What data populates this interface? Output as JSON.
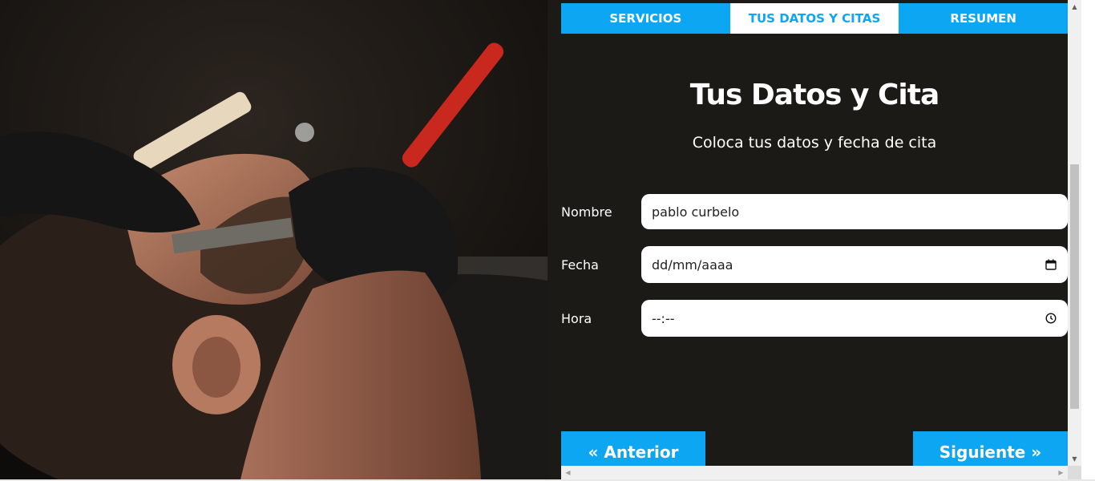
{
  "tabs": [
    {
      "label": "Servicios",
      "active": false
    },
    {
      "label": "Tus Datos y Citas",
      "active": true
    },
    {
      "label": "Resumen",
      "active": false
    }
  ],
  "section": {
    "title": "Tus Datos y Cita",
    "subtitle": "Coloca tus datos y fecha de cita"
  },
  "form": {
    "nombre": {
      "label": "Nombre",
      "value": "pablo curbelo"
    },
    "fecha": {
      "label": "Fecha",
      "placeholder": "dd/mm/aaaa",
      "icon": "calendar-icon"
    },
    "hora": {
      "label": "Hora",
      "placeholder": "--:--",
      "icon": "clock-icon"
    }
  },
  "buttons": {
    "prev": "« Anterior",
    "next": "Siguiente »"
  },
  "colors": {
    "accent": "#0da6f2",
    "panel_bg": "#1b1a16",
    "text": "#ffffff"
  }
}
